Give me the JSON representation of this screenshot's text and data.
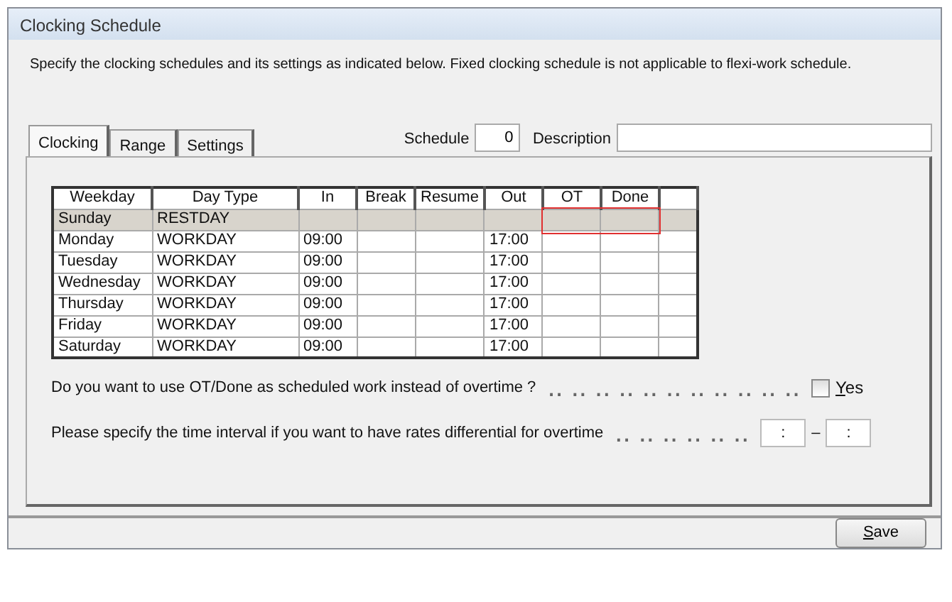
{
  "window": {
    "title": "Clocking Schedule"
  },
  "intro": "Specify the clocking schedules and its settings as indicated below. Fixed clocking schedule is not applicable to flexi-work schedule.",
  "tabs": [
    {
      "label": "Clocking",
      "selected": true
    },
    {
      "label": "Range",
      "selected": false
    },
    {
      "label": "Settings",
      "selected": false
    }
  ],
  "schedule": {
    "label": "Schedule",
    "value": "0"
  },
  "description": {
    "label": "Description"
  },
  "table": {
    "columns": [
      "Weekday",
      "Day Type",
      "In",
      "Break",
      "Resume",
      "Out",
      "OT",
      "Done"
    ],
    "rows": [
      {
        "cells": [
          "Sunday",
          "RESTDAY",
          "",
          "",
          "",
          "",
          "",
          ""
        ],
        "selected": true,
        "outlined": true
      },
      {
        "cells": [
          "Monday",
          "WORKDAY",
          "09:00",
          "",
          "",
          "17:00",
          "",
          ""
        ],
        "selected": false,
        "outlined": false
      },
      {
        "cells": [
          "Tuesday",
          "WORKDAY",
          "09:00",
          "",
          "",
          "17:00",
          "",
          ""
        ],
        "selected": false,
        "outlined": false
      },
      {
        "cells": [
          "Wednesday",
          "WORKDAY",
          "09:00",
          "",
          "",
          "17:00",
          "",
          ""
        ],
        "selected": false,
        "outlined": false
      },
      {
        "cells": [
          "Thursday",
          "WORKDAY",
          "09:00",
          "",
          "",
          "17:00",
          "",
          ""
        ],
        "selected": false,
        "outlined": false
      },
      {
        "cells": [
          "Friday",
          "WORKDAY",
          "09:00",
          "",
          "",
          "17:00",
          "",
          ""
        ],
        "selected": false,
        "outlined": false
      },
      {
        "cells": [
          "Saturday",
          "WORKDAY",
          "09:00",
          "",
          "",
          "17:00",
          "",
          ""
        ],
        "selected": false,
        "outlined": false
      }
    ]
  },
  "ot_question": {
    "text": "Do you want to use OT/Done as scheduled work instead of overtime ?",
    "leader": ".. .. .. .. .. .. .. .. .. .. ..",
    "checkbox": {
      "label": "Yes",
      "checked": false
    }
  },
  "interval": {
    "text": "Please specify the time interval if you want to have rates differential for overtime",
    "leader": ".. .. .. .. .. ..",
    "from": ":",
    "separator": "–",
    "to": ":"
  },
  "buttons": [
    {
      "label": "Save"
    }
  ]
}
